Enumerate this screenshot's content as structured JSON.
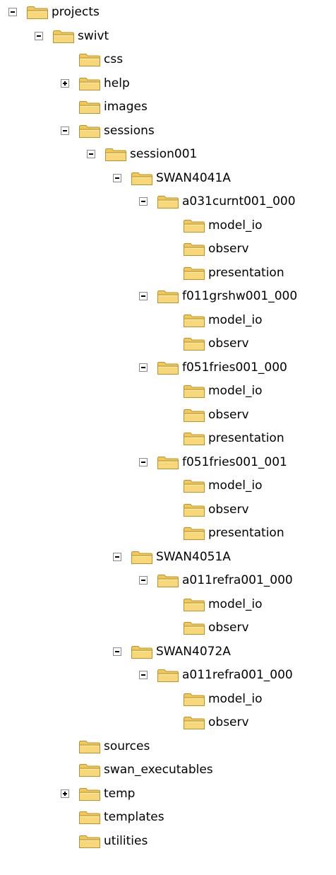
{
  "tree": {
    "nodes": [
      {
        "label": "projects",
        "depth": 0,
        "toggle": "expanded"
      },
      {
        "label": "swivt",
        "depth": 1,
        "toggle": "expanded"
      },
      {
        "label": "css",
        "depth": 2,
        "toggle": "none"
      },
      {
        "label": "help",
        "depth": 2,
        "toggle": "collapsed"
      },
      {
        "label": "images",
        "depth": 2,
        "toggle": "none"
      },
      {
        "label": "sessions",
        "depth": 2,
        "toggle": "expanded"
      },
      {
        "label": "session001",
        "depth": 3,
        "toggle": "expanded"
      },
      {
        "label": "SWAN4041A",
        "depth": 4,
        "toggle": "expanded"
      },
      {
        "label": "a031curnt001_000",
        "depth": 5,
        "toggle": "expanded"
      },
      {
        "label": "model_io",
        "depth": 6,
        "toggle": "none"
      },
      {
        "label": "observ",
        "depth": 6,
        "toggle": "none"
      },
      {
        "label": "presentation",
        "depth": 6,
        "toggle": "none"
      },
      {
        "label": "f011grshw001_000",
        "depth": 5,
        "toggle": "expanded"
      },
      {
        "label": "model_io",
        "depth": 6,
        "toggle": "none"
      },
      {
        "label": "observ",
        "depth": 6,
        "toggle": "none"
      },
      {
        "label": "f051fries001_000",
        "depth": 5,
        "toggle": "expanded"
      },
      {
        "label": "model_io",
        "depth": 6,
        "toggle": "none"
      },
      {
        "label": "observ",
        "depth": 6,
        "toggle": "none"
      },
      {
        "label": "presentation",
        "depth": 6,
        "toggle": "none"
      },
      {
        "label": "f051fries001_001",
        "depth": 5,
        "toggle": "expanded"
      },
      {
        "label": "model_io",
        "depth": 6,
        "toggle": "none"
      },
      {
        "label": "observ",
        "depth": 6,
        "toggle": "none"
      },
      {
        "label": "presentation",
        "depth": 6,
        "toggle": "none"
      },
      {
        "label": "SWAN4051A",
        "depth": 4,
        "toggle": "expanded"
      },
      {
        "label": "a011refra001_000",
        "depth": 5,
        "toggle": "expanded"
      },
      {
        "label": "model_io",
        "depth": 6,
        "toggle": "none"
      },
      {
        "label": "observ",
        "depth": 6,
        "toggle": "none"
      },
      {
        "label": "SWAN4072A",
        "depth": 4,
        "toggle": "expanded"
      },
      {
        "label": "a011refra001_000",
        "depth": 5,
        "toggle": "expanded"
      },
      {
        "label": "model_io",
        "depth": 6,
        "toggle": "none"
      },
      {
        "label": "observ",
        "depth": 6,
        "toggle": "none"
      },
      {
        "label": "sources",
        "depth": 2,
        "toggle": "none"
      },
      {
        "label": "swan_executables",
        "depth": 2,
        "toggle": "none"
      },
      {
        "label": "temp",
        "depth": 2,
        "toggle": "collapsed"
      },
      {
        "label": "templates",
        "depth": 2,
        "toggle": "none"
      },
      {
        "label": "utilities",
        "depth": 2,
        "toggle": "none"
      }
    ]
  },
  "colors": {
    "folder_body": "#f7d77a",
    "folder_tab": "#f3c85a",
    "folder_outline": "#b9932e",
    "folder_light": "#fdeeb6"
  },
  "icons": {
    "folder": "folder-icon",
    "expanded": "minus-box-icon",
    "collapsed": "plus-box-icon"
  }
}
